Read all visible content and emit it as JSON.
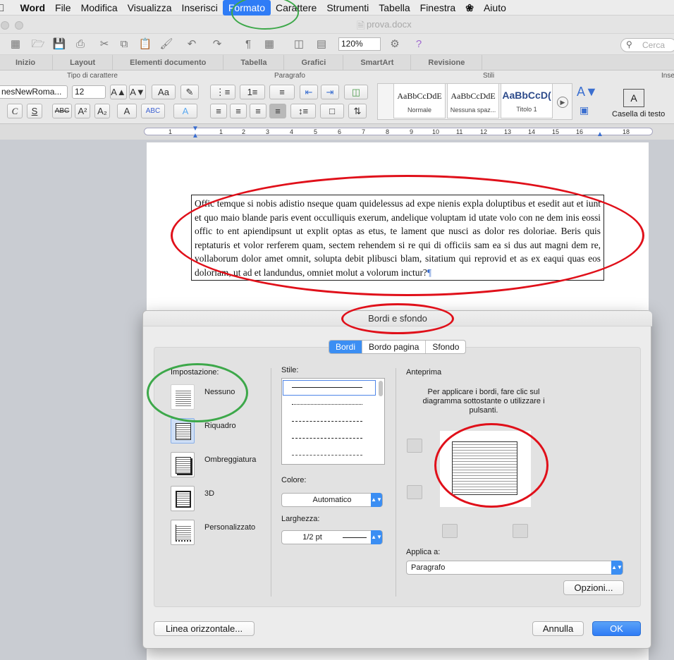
{
  "menubar": {
    "items": [
      "Word",
      "File",
      "Modifica",
      "Visualizza",
      "Inserisci",
      "Formato",
      "Carattere",
      "Strumenti",
      "Tabella",
      "Finestra",
      "Aiuto"
    ],
    "active": "Formato"
  },
  "window": {
    "title": "prova.docx"
  },
  "toolbar": {
    "zoom": "120%",
    "search_placeholder": "Cerca"
  },
  "ribbon": {
    "tabs": [
      "Inizio",
      "Layout",
      "Elementi documento",
      "Tabella",
      "Grafici",
      "SmartArt",
      "Revisione"
    ],
    "groups": {
      "font": "Tipo di carattere",
      "paragraph": "Paragrafo",
      "styles": "Stili",
      "insert": "Inse"
    },
    "font_name": "nesNewRoma...",
    "font_size": "12",
    "styles": [
      {
        "preview": "AaBbCcDdE",
        "name": "Normale"
      },
      {
        "preview": "AaBbCcDdE",
        "name": "Nessuna spaz..."
      },
      {
        "preview": "AaBbCcD(",
        "name": "Titolo 1"
      }
    ],
    "text_box": "Casella di testo"
  },
  "ruler": {
    "marks": [
      "1",
      "1",
      "2",
      "3",
      "4",
      "5",
      "6",
      "7",
      "8",
      "9",
      "10",
      "11",
      "12",
      "13",
      "14",
      "15",
      "16",
      "18"
    ]
  },
  "document": {
    "paragraph": "Offic temque si nobis adistio nseque quam quidelessus ad expe nienis expla doluptibus et esedit aut et iunt et quo maio blande paris event occulliquis exerum, andelique voluptam id utate volo con ne dem inis eossi offic to ent apiendipsunt ut explit optas as etus, te lament que nusci as dolor res doloriae. Beris quis reptaturis et volor rerferem quam, sectem rehendem si re qui di officiis sam ea si dus aut magni dem re, vollaborum dolor amet omnit, solupta debit plibusci blam, sitatium qui reprovid et as ex eaqui quas eos doloriam, ut ad et landundus, omniet molut a volorum inctur?",
    "para_mark": "¶"
  },
  "dialog": {
    "title": "Bordi e sfondo",
    "tabs": [
      "Bordi",
      "Bordo pagina",
      "Sfondo"
    ],
    "setting_label": "Impostazione:",
    "settings": [
      "Nessuno",
      "Riquadro",
      "Ombreggiatura",
      "3D",
      "Personalizzato"
    ],
    "style_label": "Stile:",
    "color_label": "Colore:",
    "color_value": "Automatico",
    "width_label": "Larghezza:",
    "width_value": "1/2 pt",
    "preview_label": "Anteprima",
    "preview_hint": "Per applicare i bordi, fare clic sul diagramma sottostante o utilizzare i pulsanti.",
    "apply_label": "Applica a:",
    "apply_value": "Paragrafo",
    "options_button": "Opzioni...",
    "horizontal_line_button": "Linea orizzontale...",
    "cancel_button": "Annulla",
    "ok_button": "OK"
  },
  "colors": {
    "accent": "#2f7cf6",
    "annotation_red": "#e0101a",
    "annotation_green": "#3da84a"
  }
}
